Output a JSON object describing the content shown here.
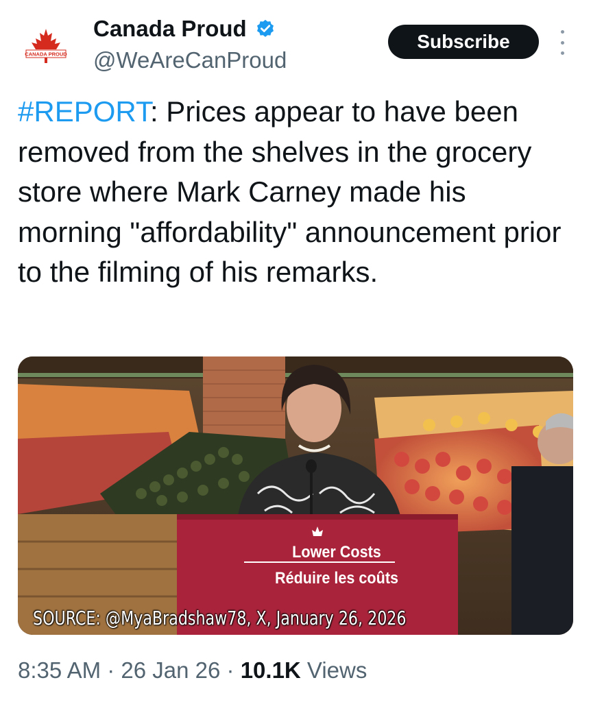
{
  "author": {
    "display_name": "Canada Proud",
    "handle": "@WeAreCanProud",
    "avatar_text": "CANADA PROUD",
    "verified": true,
    "avatar_icon": "maple-leaf-icon"
  },
  "actions": {
    "subscribe_label": "Subscribe",
    "more_icon": "more-vertical-icon"
  },
  "tweet": {
    "hashtag": "#REPORT",
    "body": ": Prices appear to have been removed from the shelves in the grocery store where Mark Carney made his morning \"affordability\" announcement prior to the filming of his remarks."
  },
  "media": {
    "podium_line1": "Lower Costs",
    "podium_line2": "Réduire les coûts",
    "caption": "SOURCE: @MyaBradshaw78, X, January 26, 2026"
  },
  "meta": {
    "time": "8:35 AM",
    "separator": " · ",
    "date": "26 Jan 26",
    "views_count": "10.1K",
    "views_label": " Views"
  },
  "colors": {
    "link": "#1d9bf0",
    "text": "#0f1419",
    "secondary": "#536471",
    "brand_red": "#d52b1e"
  }
}
